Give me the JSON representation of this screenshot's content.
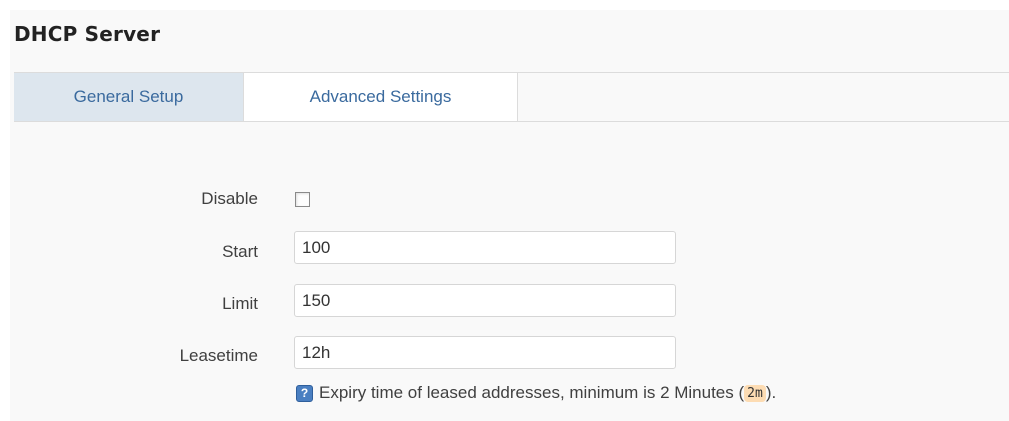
{
  "section": {
    "title": "DHCP Server"
  },
  "tabs": [
    {
      "label": "General Setup",
      "active": true
    },
    {
      "label": "Advanced Settings",
      "active": false
    }
  ],
  "form": {
    "disable": {
      "label": "Disable",
      "checked": false
    },
    "start": {
      "label": "Start",
      "value": "100"
    },
    "limit": {
      "label": "Limit",
      "value": "150"
    },
    "leasetime": {
      "label": "Leasetime",
      "value": "12h",
      "help_prefix": "Expiry time of leased addresses, minimum is 2 Minutes (",
      "help_code": "2m",
      "help_suffix": ")."
    }
  },
  "icons": {
    "help": "help-icon"
  },
  "colors": {
    "tab_active_bg": "#dde6ee",
    "tab_text": "#3a6a9e",
    "code_bg": "#fddcb3",
    "help_icon": "#4a7fc1"
  }
}
